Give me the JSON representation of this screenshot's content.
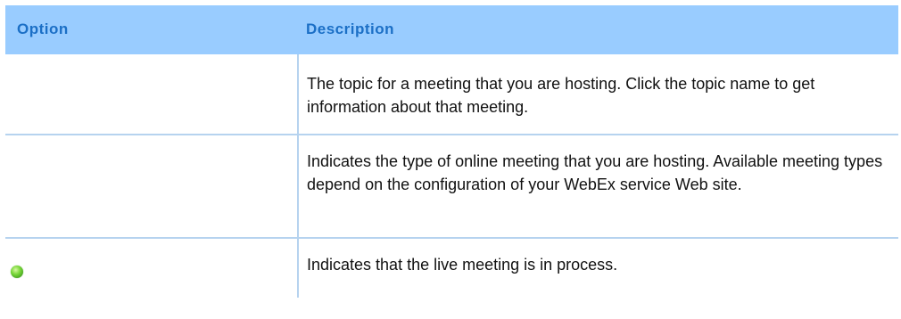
{
  "table": {
    "headers": {
      "option": "Option",
      "description": "Description"
    },
    "rows": [
      {
        "option": "",
        "description": "The topic for a meeting that you are hosting. Click the topic name to get information about that meeting."
      },
      {
        "option": "",
        "description": "Indicates the type of online meeting that you are hosting. Available meeting types depend on the configuration of your WebEx service Web site."
      },
      {
        "option_icon": "live-meeting-status-icon",
        "description": "Indicates that the live meeting is in process."
      }
    ]
  },
  "colors": {
    "header_background": "#99ccff",
    "header_text": "#1b6fc6",
    "divider": "#b6d3ef",
    "status_icon": "#5fc22a"
  }
}
